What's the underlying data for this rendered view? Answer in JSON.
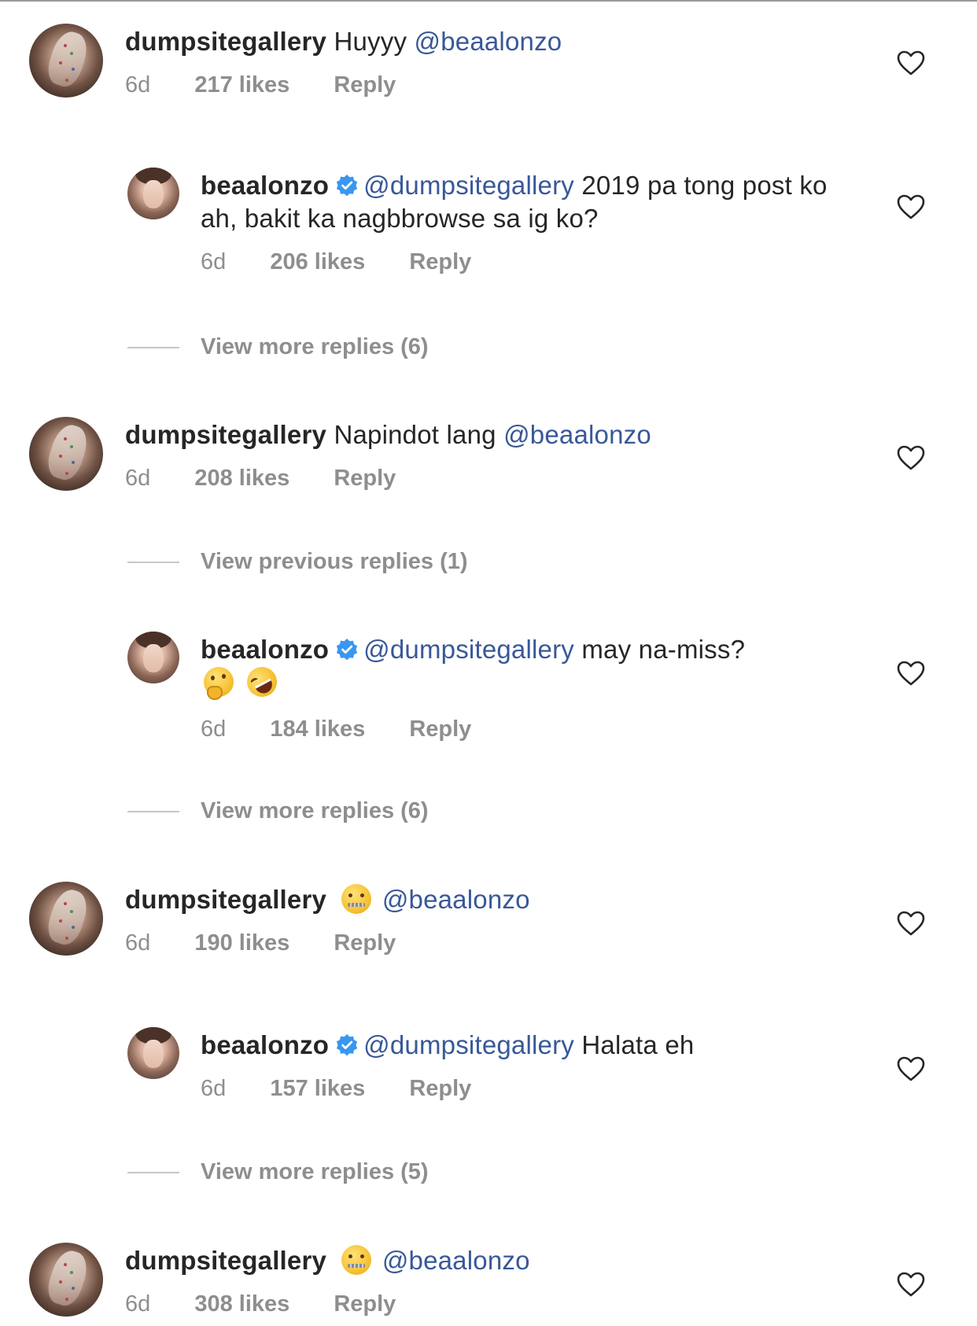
{
  "thread": [
    {
      "kind": "comment",
      "username": "dumpsitegallery",
      "text": "Huyyy",
      "mention": "@beaalonzo",
      "time": "6d",
      "likes": "217 likes",
      "reply": "Reply"
    },
    {
      "kind": "reply",
      "username": "beaalonzo",
      "verified": true,
      "mention": "@dumpsitegallery",
      "text": "2019 pa tong post ko ah, bakit ka nagbbrowse sa ig ko?",
      "time": "6d",
      "likes": "206 likes",
      "reply": "Reply"
    },
    {
      "kind": "view",
      "text": "View more replies (6)"
    },
    {
      "kind": "comment",
      "username": "dumpsitegallery",
      "text": "Napindot lang",
      "mention": "@beaalonzo",
      "time": "6d",
      "likes": "208 likes",
      "reply": "Reply"
    },
    {
      "kind": "view",
      "text": "View previous replies (1)"
    },
    {
      "kind": "reply",
      "username": "beaalonzo",
      "verified": true,
      "mention": "@dumpsitegallery",
      "text": "may na-miss?",
      "emojis": [
        "thinking-face-emoji",
        "rolling-on-floor-laughing-emoji"
      ],
      "time": "6d",
      "likes": "184 likes",
      "reply": "Reply"
    },
    {
      "kind": "view",
      "text": "View more replies (6)"
    },
    {
      "kind": "comment",
      "username": "dumpsitegallery",
      "emojis": [
        "zipper-mouth-face-emoji"
      ],
      "mention": "@beaalonzo",
      "time": "6d",
      "likes": "190 likes",
      "reply": "Reply"
    },
    {
      "kind": "reply",
      "username": "beaalonzo",
      "verified": true,
      "mention": "@dumpsitegallery",
      "text": "Halata eh",
      "time": "6d",
      "likes": "157 likes",
      "reply": "Reply"
    },
    {
      "kind": "view",
      "text": "View more replies (5)"
    },
    {
      "kind": "comment",
      "username": "dumpsitegallery",
      "emojis": [
        "zipper-mouth-face-emoji"
      ],
      "mention": "@beaalonzo",
      "time": "6d",
      "likes": "308 likes",
      "reply": "Reply"
    }
  ],
  "icons": {
    "like": "heart-outline-icon",
    "verified": "verified-badge-icon"
  },
  "colors": {
    "text": "#262626",
    "secondary": "#8e8e8e",
    "mention": "#385898",
    "verified": "#3897f0",
    "divider": "#c7c7c7"
  }
}
